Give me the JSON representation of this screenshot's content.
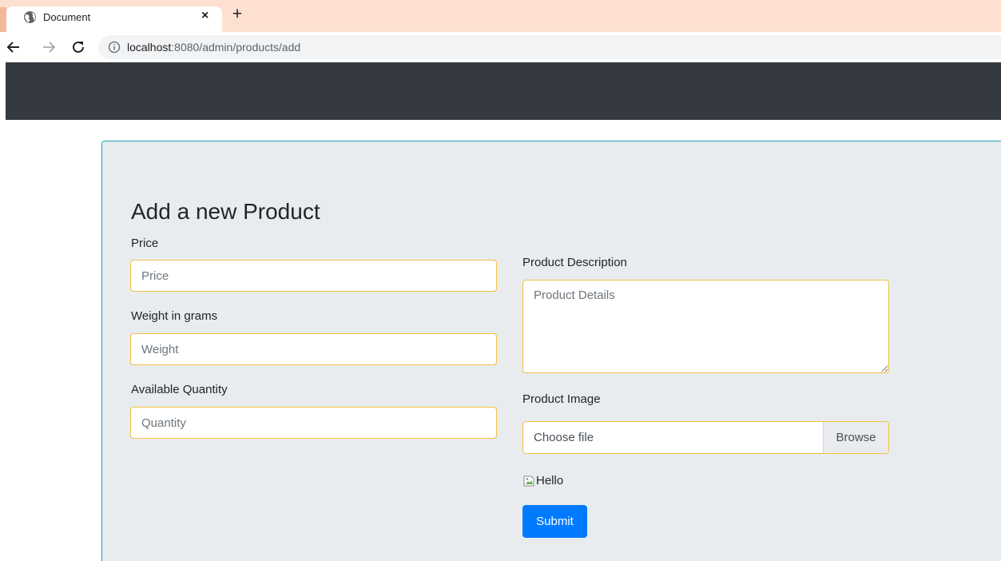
{
  "browser": {
    "tab_title": "Document",
    "close_symbol": "×",
    "new_tab_symbol": "+",
    "url_host": "localhost",
    "url_rest": ":8080/admin/products/add",
    "icons": [
      "globe-icon",
      "close-icon",
      "plus-icon",
      "back-arrow-icon",
      "forward-arrow-icon",
      "reload-icon",
      "info-icon"
    ]
  },
  "form": {
    "heading": "Add a new Product",
    "price": {
      "label": "Price",
      "placeholder": "Price",
      "value": ""
    },
    "weight": {
      "label": "Weight in grams",
      "placeholder": "Weight",
      "value": ""
    },
    "quantity": {
      "label": "Available Quantity",
      "placeholder": "Quantity",
      "value": ""
    },
    "description": {
      "label": "Product Description",
      "placeholder": "Product Details",
      "value": ""
    },
    "image": {
      "label": "Product Image",
      "file_text": "Choose file",
      "browse_label": "Browse"
    },
    "image_alt": "Hello",
    "submit_label": "Submit"
  },
  "colors": {
    "tabstrip": "#fde0cf",
    "navbar": "#343a40",
    "jumbotron_bg": "#e9ecef",
    "jumbotron_border": "#17a2b8",
    "field_border": "#f0c040",
    "primary": "#007bff"
  }
}
